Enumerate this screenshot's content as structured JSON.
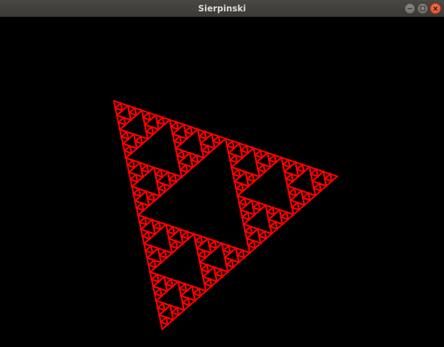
{
  "window": {
    "title": "Sierpinski",
    "controls": [
      "minimize-icon",
      "maximize-icon",
      "close-icon"
    ]
  },
  "canvas": {
    "background": "#000000",
    "stroke_color": "#ff0000"
  }
}
